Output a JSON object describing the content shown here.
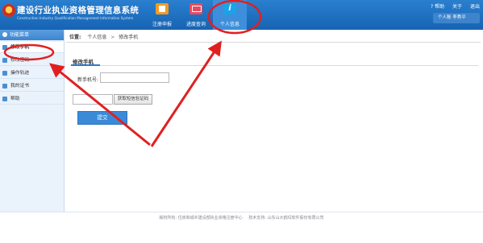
{
  "header": {
    "title": "建设行业执业资格管理信息系统",
    "subtitle": "Construction Industry Qualification Management Information System",
    "nav": [
      {
        "label": "注册申报",
        "icon": "report-icon"
      },
      {
        "label": "进度查询",
        "icon": "progress-icon"
      },
      {
        "label": "个人信息",
        "icon": "info-icon",
        "glyph": "i"
      }
    ],
    "top_links": {
      "help": "? 帮助",
      "about": "关于",
      "logout": "退出"
    },
    "user": "个人账  李秀平"
  },
  "sidebar": {
    "title": "功能菜单",
    "items": [
      {
        "label": "修改手机"
      },
      {
        "label": "修改密码"
      },
      {
        "label": "操作轨迹"
      },
      {
        "label": "我的证书"
      },
      {
        "label": "帮助"
      }
    ]
  },
  "breadcrumb": {
    "label": "位置:",
    "items": [
      "个人信息",
      "修改手机"
    ],
    "separator": ">"
  },
  "form": {
    "section_title": "修改手机",
    "phone_label": "新手机号:",
    "phone_value": "",
    "code_value": "",
    "code_button": "获取短信验证码",
    "submit": "提交"
  },
  "footer": {
    "copyright": "版权所有: 住房和城乡建设部执业资格注册中心",
    "support": "技术支持: 山东山大鸥玛软件股份有限公司"
  },
  "colors": {
    "header": "#1763b3",
    "accent": "#3a8ad8",
    "annotation": "#e02020"
  }
}
